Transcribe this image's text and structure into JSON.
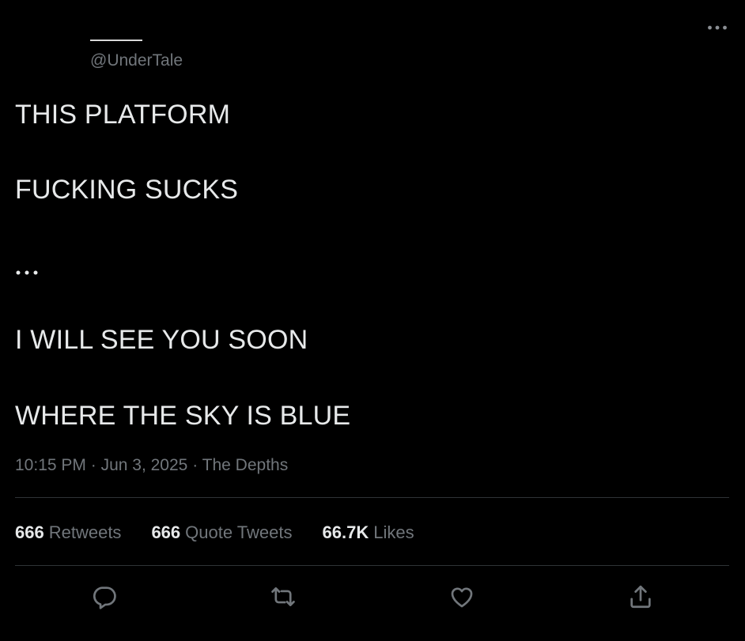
{
  "author": {
    "display_name": "____",
    "handle": "@UnderTale"
  },
  "menu": {
    "more_icon": "more-horizontal-icon"
  },
  "tweet": {
    "lines": [
      "THIS PLATFORM",
      "FUCKING SUCKS",
      "...",
      "I WILL SEE YOU SOON",
      "WHERE THE SKY IS BLUE"
    ]
  },
  "meta": {
    "time": "10:15 PM",
    "separator": "·",
    "date": "Jun 3, 2025",
    "location": "The Depths"
  },
  "stats": {
    "retweets": {
      "count": "666",
      "label": "Retweets"
    },
    "quote_tweets": {
      "count": "666",
      "label": "Quote Tweets"
    },
    "likes": {
      "count": "66.7K",
      "label": "Likes"
    }
  },
  "actions": [
    {
      "name": "reply",
      "icon": "reply-icon"
    },
    {
      "name": "retweet",
      "icon": "retweet-icon"
    },
    {
      "name": "like",
      "icon": "heart-icon"
    },
    {
      "name": "share",
      "icon": "share-icon"
    }
  ],
  "colors": {
    "background": "#000000",
    "text": "#e7e9ea",
    "secondary_text": "#71767b",
    "divider": "#2f3336"
  }
}
